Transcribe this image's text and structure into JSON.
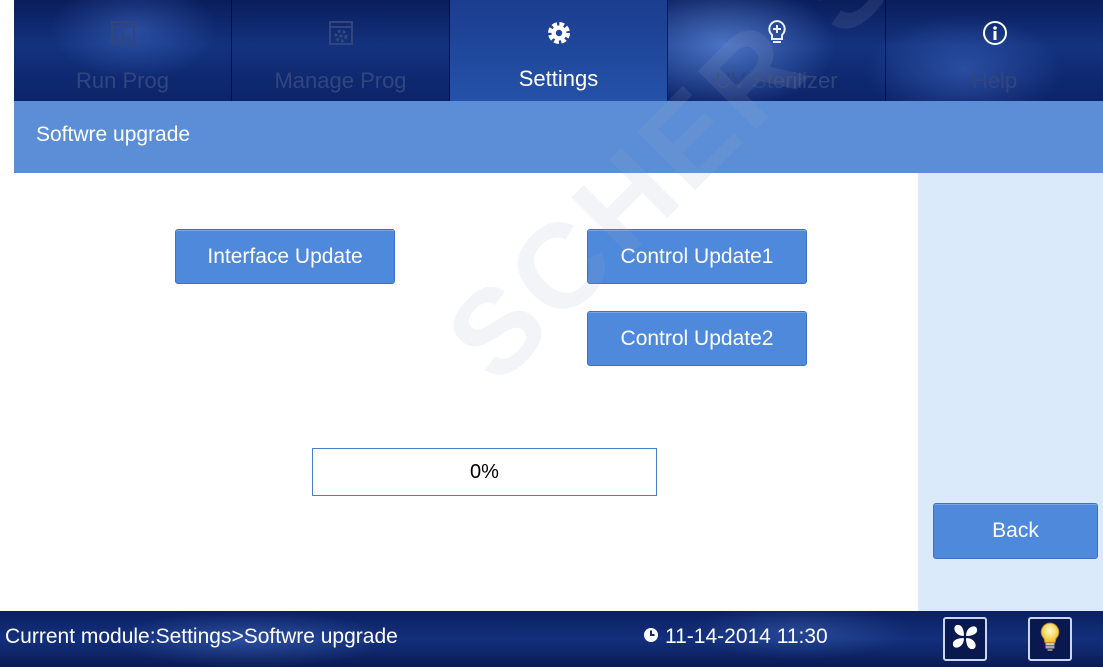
{
  "nav": {
    "tabs": [
      {
        "label": "Run Prog",
        "icon": "chart-icon",
        "active": false
      },
      {
        "label": "Manage Prog",
        "icon": "gear-box-icon",
        "active": false
      },
      {
        "label": "Settings",
        "icon": "gear-icon",
        "active": true
      },
      {
        "label": "UV Sterilizer",
        "icon": "bulb-plus-icon",
        "active": false
      },
      {
        "label": "Help",
        "icon": "info-icon",
        "active": false
      }
    ]
  },
  "page": {
    "title": "Softwre upgrade"
  },
  "buttons": {
    "interface_update": "Interface Update",
    "control_update1": "Control Update1",
    "control_update2": "Control Update2",
    "back": "Back"
  },
  "progress": {
    "text": "0%",
    "value": 0
  },
  "status": {
    "module": "Current module:Settings>Softwre upgrade",
    "datetime": "11-14-2014 11:30"
  },
  "watermark": "SCHER S",
  "colors": {
    "accent": "#4f89dc",
    "titlebar": "#5b8ed6",
    "sidebar": "#daeafb",
    "nav_dark": "#0f2a70"
  }
}
